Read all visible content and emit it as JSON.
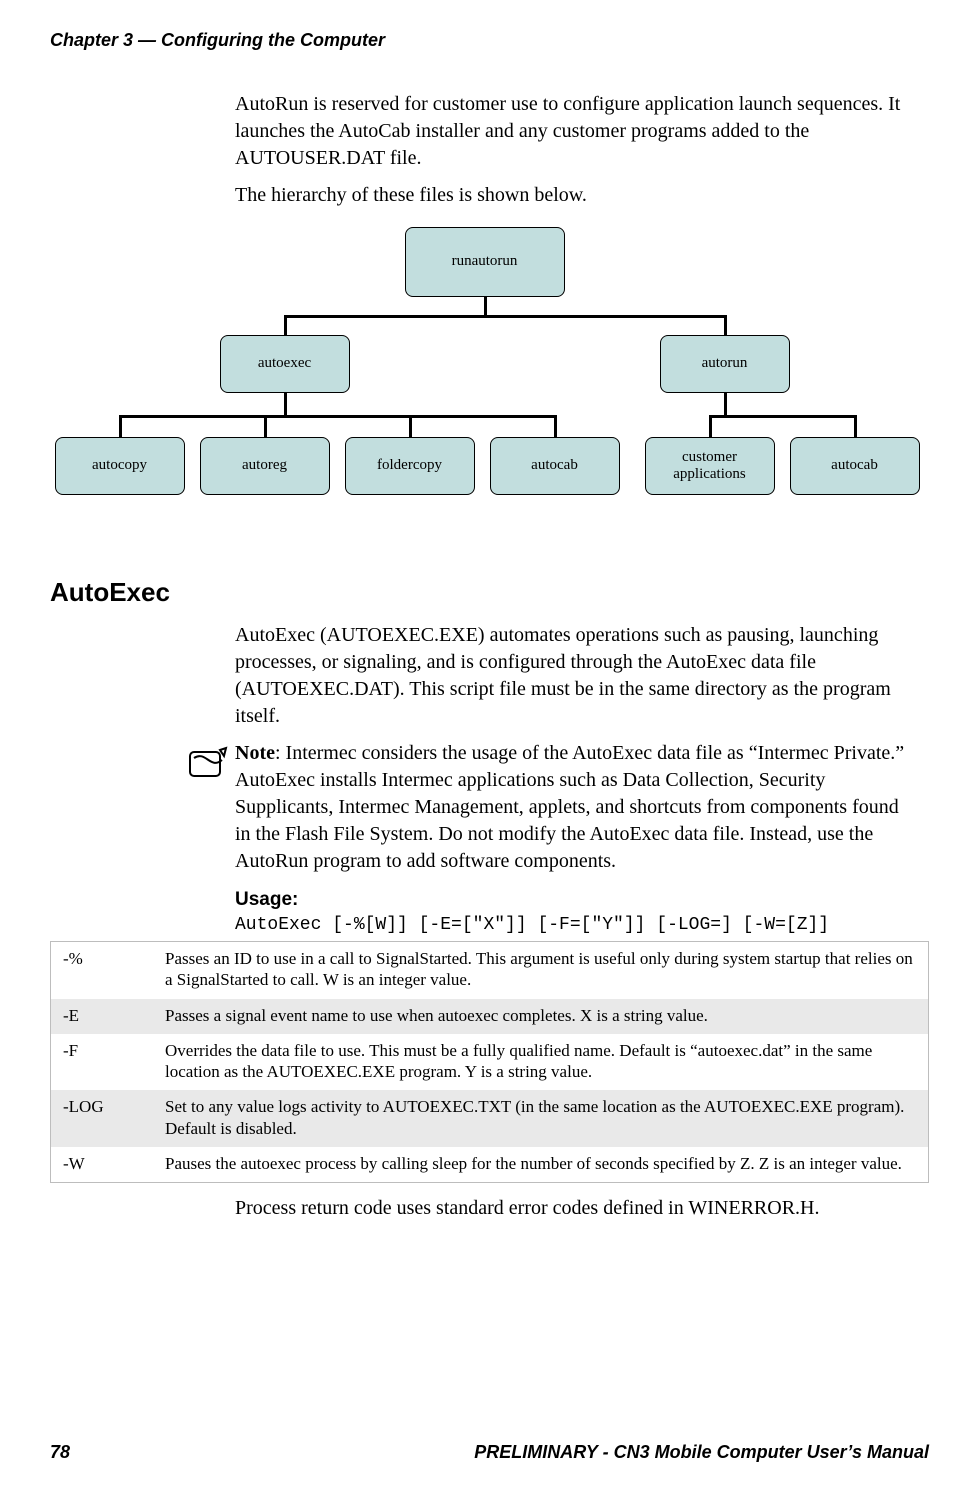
{
  "running_header": "Chapter 3 — Configuring the Computer",
  "intro_p1": "AutoRun is reserved for customer use to configure application launch sequences. It launches the AutoCab installer and any customer programs added to the AUTOUSER.DAT file.",
  "intro_p2": "The hierarchy of these files is shown below.",
  "diagram": {
    "root": "runautorun",
    "l1a": "autoexec",
    "l1b": "autorun",
    "l2a": "autocopy",
    "l2b": "autoreg",
    "l2c": "foldercopy",
    "l2d": "autocab",
    "l2e_line1": "customer",
    "l2e_line2": "applications",
    "l2f": "autocab"
  },
  "section_heading": "AutoExec",
  "autoexec_p1": "AutoExec (AUTOEXEC.EXE) automates operations such as pausing, launching processes, or signaling, and is configured through the AutoExec data file (AUTOEXEC.DAT). This script file must be in the same direc­tory as the program itself.",
  "note_label": "Note",
  "note_text": ": Intermec considers the usage of the AutoExec data file as “Intermec Private.” AutoExec installs Intermec applications such as Data Collection, Security Supplicants, Intermec Management, applets, and shortcuts from components found in the Flash File System. Do not modify the AutoExec data file. Instead, use the AutoRun program to add software components.",
  "usage_heading": "Usage:",
  "usage_code": "AutoExec [-%[W]] [-E=[\"X\"]] [-F=[\"Y\"]] [-LOG=] [-W=[Z]]",
  "params": [
    {
      "flag": "-%",
      "desc": "Passes an ID to use in a call to SignalStarted. This argument is useful only during system startup that relies on a SignalStarted to call. W is an integer value."
    },
    {
      "flag": "-E",
      "desc": "Passes a signal event name to use when autoexec completes. X is a string value."
    },
    {
      "flag": "-F",
      "desc": "Overrides the data file to use. This must be a fully qualified name. Default is “autoexec.dat” in the same location as the AUTOEXEC.EXE program. Y is a string value."
    },
    {
      "flag": "-LOG",
      "desc": "Set to any value logs activity to AUTOEXEC.TXT (in the same location as the AUTOEXEC.EXE pro­gram). Default is disabled."
    },
    {
      "flag": "-W",
      "desc": "Pauses the autoexec process by calling sleep for the number of seconds specified by Z. Z is an integer value."
    }
  ],
  "after_table_p": "Process return code uses standard error codes defined in WINERROR.H.",
  "footer_left": "78",
  "footer_right": "PRELIMINARY - CN3 Mobile Computer User’s Manual"
}
